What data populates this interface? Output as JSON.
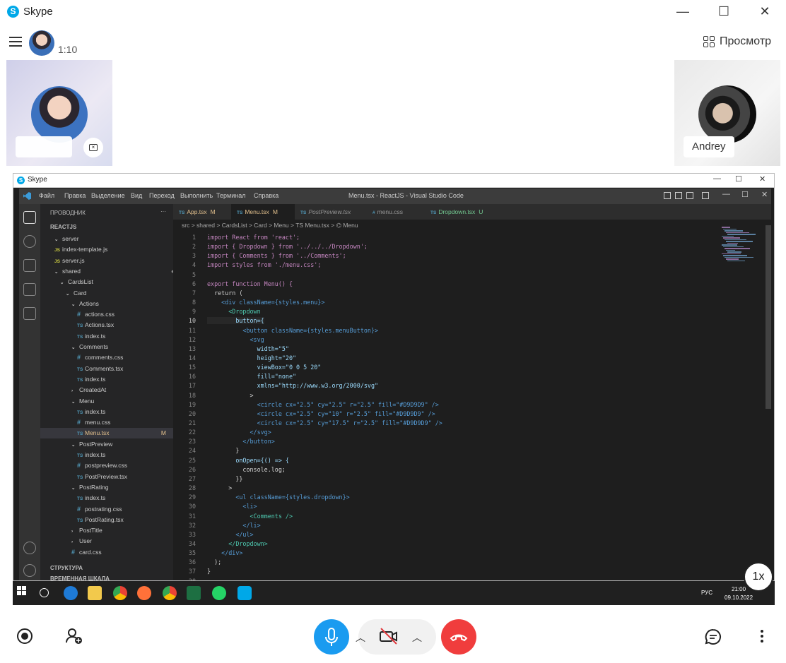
{
  "window": {
    "title": "Skype",
    "minimize": "—",
    "maximize": "☐",
    "close": "✕"
  },
  "header": {
    "call_timer": "1:10",
    "view_label": "Просмотр"
  },
  "participants": [
    {
      "name": ""
    },
    {
      "name": "Andrey"
    }
  ],
  "shared_screen": {
    "window_title": "Skype",
    "vscode": {
      "menu": [
        "Файл",
        "Правка",
        "Выделение",
        "Вид",
        "Переход",
        "Выполнить",
        "Терминал",
        "Справка"
      ],
      "title": "Menu.tsx - ReactJS - Visual Studio Code",
      "explorer_title": "ПРОВОДНИК",
      "explorer_more": "···",
      "root": "REACTJS",
      "tree": [
        {
          "name": "server",
          "depth": 1,
          "kind": "folder"
        },
        {
          "name": "index-template.js",
          "depth": 1,
          "kind": "js"
        },
        {
          "name": "server.js",
          "depth": 1,
          "kind": "js"
        },
        {
          "name": "shared",
          "depth": 1,
          "kind": "folder",
          "mark": "●"
        },
        {
          "name": "CardsList",
          "depth": 2,
          "kind": "folder",
          "mark": "●"
        },
        {
          "name": "Card",
          "depth": 3,
          "kind": "folder",
          "mark": "●"
        },
        {
          "name": "Actions",
          "depth": 4,
          "kind": "folder"
        },
        {
          "name": "actions.css",
          "depth": 5,
          "kind": "css"
        },
        {
          "name": "Actions.tsx",
          "depth": 5,
          "kind": "ts"
        },
        {
          "name": "index.ts",
          "depth": 5,
          "kind": "ts"
        },
        {
          "name": "Comments",
          "depth": 4,
          "kind": "folder"
        },
        {
          "name": "comments.css",
          "depth": 5,
          "kind": "css"
        },
        {
          "name": "Comments.tsx",
          "depth": 5,
          "kind": "ts"
        },
        {
          "name": "index.ts",
          "depth": 5,
          "kind": "ts"
        },
        {
          "name": "CreatedAt",
          "depth": 4,
          "kind": "folder-closed"
        },
        {
          "name": "Menu",
          "depth": 4,
          "kind": "folder",
          "mark": "●"
        },
        {
          "name": "index.ts",
          "depth": 5,
          "kind": "ts"
        },
        {
          "name": "menu.css",
          "depth": 5,
          "kind": "css"
        },
        {
          "name": "Menu.tsx",
          "depth": 5,
          "kind": "ts",
          "mark": "M",
          "selected": true
        },
        {
          "name": "PostPreview",
          "depth": 4,
          "kind": "folder"
        },
        {
          "name": "index.ts",
          "depth": 5,
          "kind": "ts"
        },
        {
          "name": "postpreview.css",
          "depth": 5,
          "kind": "css"
        },
        {
          "name": "PostPreview.tsx",
          "depth": 5,
          "kind": "ts"
        },
        {
          "name": "PostRating",
          "depth": 4,
          "kind": "folder"
        },
        {
          "name": "index.ts",
          "depth": 5,
          "kind": "ts"
        },
        {
          "name": "postrating.css",
          "depth": 5,
          "kind": "css"
        },
        {
          "name": "PostRating.tsx",
          "depth": 5,
          "kind": "ts"
        },
        {
          "name": "PostTitle",
          "depth": 4,
          "kind": "folder-closed"
        },
        {
          "name": "User",
          "depth": 4,
          "kind": "folder-closed"
        },
        {
          "name": "card.css",
          "depth": 4,
          "kind": "css"
        }
      ],
      "outline": "СТРУКТУРА",
      "timeline": "ВРЕМЕННАЯ ШКАЛА",
      "tabs": [
        {
          "label": "App.tsx",
          "badge": "M",
          "kind": "ts"
        },
        {
          "label": "Menu.tsx",
          "badge": "M",
          "kind": "ts",
          "active": true
        },
        {
          "label": "PostPreview.tsx",
          "badge": "",
          "kind": "ts"
        },
        {
          "label": "menu.css",
          "badge": "",
          "kind": "css"
        },
        {
          "label": "Dropdown.tsx",
          "badge": "U",
          "kind": "ts"
        }
      ],
      "breadcrumb": "src > shared > CardsList > Card > Menu > TS Menu.tsx > ⌬ Menu",
      "code": [
        "import React from 'react';",
        "import { Dropdown } from '../../../Dropdown';",
        "import { Comments } from '../Comments';",
        "import styles from './menu.css';",
        "",
        "export function Menu() {",
        "  return (",
        "    <div className={styles.menu}>",
        "      <Dropdown",
        "        button={",
        "          <button className={styles.menuButton}>",
        "            <svg",
        "              width=\"5\"",
        "              height=\"20\"",
        "              viewBox=\"0 0 5 20\"",
        "              fill=\"none\"",
        "              xmlns=\"http://www.w3.org/2000/svg\"",
        "            >",
        "              <circle cx=\"2.5\" cy=\"2.5\" r=\"2.5\" fill=\"#D9D9D9\" />",
        "              <circle cx=\"2.5\" cy=\"10\" r=\"2.5\" fill=\"#D9D9D9\" />",
        "              <circle cx=\"2.5\" cy=\"17.5\" r=\"2.5\" fill=\"#D9D9D9\" />",
        "            </svg>",
        "          </button>",
        "        }",
        "        onOpen={() => {",
        "          console.log;",
        "        }}",
        "      >",
        "        <ul className={styles.dropdown}>",
        "          <li>",
        "            <Comments />",
        "          </li>",
        "        </ul>",
        "      </Dropdown>",
        "    </div>",
        "  );",
        "}",
        ""
      ]
    },
    "taskbar": {
      "lang": "РУС",
      "time": "21:00",
      "date": "09.10.2022"
    },
    "speed_badge": "1x"
  },
  "colors": {
    "mic": "#1a9bf0",
    "hangup": "#f03d3d",
    "skype": "#00a8e8"
  }
}
